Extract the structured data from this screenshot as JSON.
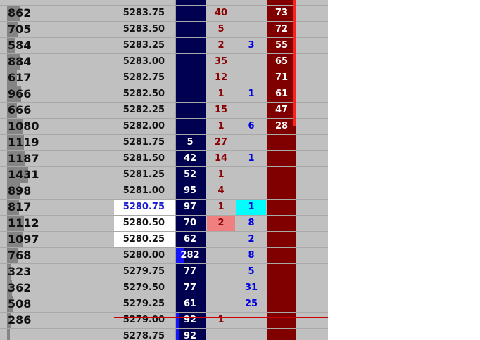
{
  "colors": {
    "panel": "#c0c0c0",
    "volume_bar": "#848484",
    "bid_column": "#000050",
    "bid_bar": "#1414ff",
    "ask_column": "#800000",
    "sell_text": "#8b0000",
    "buy_text": "#0000dd",
    "highlight_price_text": "#1a1ad0",
    "last_trade_line": "#cc0000",
    "cyan_cell": "#00ffff",
    "pink_cell": "#f08080"
  },
  "ladder": {
    "rows": [
      {
        "volume": "",
        "volume_level": 0,
        "price": "",
        "bid": "",
        "bid_level": 0,
        "sell": "",
        "buy": "",
        "ask": "73",
        "price_hl": false
      },
      {
        "volume": "862",
        "volume_level": 0.6,
        "price": "5283.75",
        "bid": "",
        "bid_level": 0,
        "sell": "40",
        "buy": "",
        "ask": "73"
      },
      {
        "volume": "705",
        "volume_level": 0.5,
        "price": "5283.50",
        "bid": "",
        "bid_level": 0,
        "sell": "5",
        "buy": "",
        "ask": "72"
      },
      {
        "volume": "584",
        "volume_level": 0.4,
        "price": "5283.25",
        "bid": "",
        "bid_level": 0,
        "sell": "2",
        "buy": "3",
        "ask": "55"
      },
      {
        "volume": "884",
        "volume_level": 0.6,
        "price": "5283.00",
        "bid": "",
        "bid_level": 0,
        "sell": "35",
        "buy": "",
        "ask": "65"
      },
      {
        "volume": "617",
        "volume_level": 0.45,
        "price": "5282.75",
        "bid": "",
        "bid_level": 0,
        "sell": "12",
        "buy": "",
        "ask": "71"
      },
      {
        "volume": "966",
        "volume_level": 0.65,
        "price": "5282.50",
        "bid": "",
        "bid_level": 0,
        "sell": "1",
        "buy": "1",
        "ask": "61"
      },
      {
        "volume": "666",
        "volume_level": 0.45,
        "price": "5282.25",
        "bid": "",
        "bid_level": 0,
        "sell": "15",
        "buy": "",
        "ask": "47"
      },
      {
        "volume": "1080",
        "volume_level": 0.75,
        "price": "5282.00",
        "bid": "",
        "bid_level": 0,
        "sell": "1",
        "buy": "6",
        "ask": "28"
      },
      {
        "volume": "1119",
        "volume_level": 0.8,
        "price": "5281.75",
        "bid": "5",
        "bid_level": 0,
        "sell": "27",
        "buy": "",
        "ask": ""
      },
      {
        "volume": "1187",
        "volume_level": 0.85,
        "price": "5281.50",
        "bid": "42",
        "bid_level": 0,
        "sell": "14",
        "buy": "1",
        "ask": ""
      },
      {
        "volume": "1431",
        "volume_level": 1.0,
        "price": "5281.25",
        "bid": "52",
        "bid_level": 0,
        "sell": "1",
        "buy": "",
        "ask": ""
      },
      {
        "volume": "898",
        "volume_level": 0.6,
        "price": "5281.00",
        "bid": "95",
        "bid_level": 0,
        "sell": "4",
        "buy": "",
        "ask": ""
      },
      {
        "volume": "817",
        "volume_level": 0.55,
        "price": "5280.75",
        "bid": "97",
        "bid_level": 0,
        "sell": "1",
        "buy": "1",
        "ask": "",
        "price_hl": true,
        "buy_cyan": true
      },
      {
        "volume": "1112",
        "volume_level": 0.8,
        "price": "5280.50",
        "bid": "70",
        "bid_level": 0,
        "sell": "2",
        "buy": "8",
        "ask": "",
        "price_plain_hl": true,
        "sell_pink": true
      },
      {
        "volume": "1097",
        "volume_level": 0.75,
        "price": "5280.25",
        "bid": "62",
        "bid_level": 0,
        "sell": "",
        "buy": "2",
        "ask": "",
        "price_plain_hl": true
      },
      {
        "volume": "768",
        "volume_level": 0.5,
        "price": "5280.00",
        "bid": "282",
        "bid_level": 0.25,
        "sell": "",
        "buy": "8",
        "ask": ""
      },
      {
        "volume": "323",
        "volume_level": 0.2,
        "price": "5279.75",
        "bid": "77",
        "bid_level": 0,
        "sell": "",
        "buy": "5",
        "ask": ""
      },
      {
        "volume": "362",
        "volume_level": 0.22,
        "price": "5279.50",
        "bid": "77",
        "bid_level": 0,
        "sell": "",
        "buy": "31",
        "ask": ""
      },
      {
        "volume": "508",
        "volume_level": 0.3,
        "price": "5279.25",
        "bid": "61",
        "bid_level": 0,
        "sell": "",
        "buy": "25",
        "ask": ""
      },
      {
        "volume": "286",
        "volume_level": 0.15,
        "price": "5279.00",
        "bid": "92",
        "bid_level": 0.12,
        "sell": "1",
        "buy": "",
        "ask": ""
      },
      {
        "volume": "",
        "volume_level": 0.12,
        "price": "5278.75",
        "bid": "92",
        "bid_level": 0.12,
        "sell": "",
        "buy": "",
        "ask": ""
      }
    ]
  }
}
